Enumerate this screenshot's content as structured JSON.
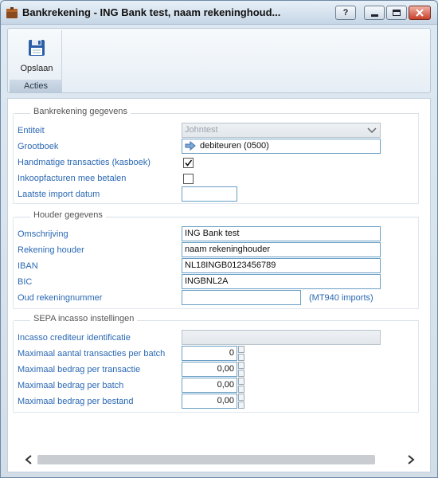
{
  "window": {
    "title": "Bankrekening - ING Bank test, naam rekeninghoud..."
  },
  "ribbon": {
    "save_label": "Opslaan",
    "group_label": "Acties"
  },
  "sections": {
    "bank": {
      "title": "Bankrekening gegevens"
    },
    "houder": {
      "title": "Houder gegevens"
    },
    "sepa": {
      "title": "SEPA incasso instellingen"
    }
  },
  "bank": {
    "entiteit_label": "Entiteit",
    "entiteit_value": "Johntest",
    "grootboek_label": "Grootboek",
    "grootboek_value": "debiteuren (0500)",
    "handmatig_label": "Handmatige transacties (kasboek)",
    "handmatig_checked": true,
    "inkoop_label": "Inkoopfacturen mee betalen",
    "inkoop_checked": false,
    "import_label": "Laatste import datum",
    "import_value": ""
  },
  "houder": {
    "omschrijving_label": "Omschrijving",
    "omschrijving_value": "ING Bank test",
    "rekening_houder_label": "Rekening houder",
    "rekening_houder_value": "naam rekeninghouder",
    "iban_label": "IBAN",
    "iban_value": "NL18INGB0123456789",
    "bic_label": "BIC",
    "bic_value": "INGBNL2A",
    "oud_label": "Oud rekeningnummer",
    "oud_value": "",
    "oud_suffix": "(MT940 imports)"
  },
  "sepa": {
    "crediteur_label": "Incasso crediteur identificatie",
    "crediteur_value": "",
    "max_trans_batch_label": "Maximaal aantal transacties per batch",
    "max_trans_batch_value": "0",
    "max_bedrag_trans_label": "Maximaal bedrag per transactie",
    "max_bedrag_trans_value": "0,00",
    "max_bedrag_batch_label": "Maximaal bedrag per batch",
    "max_bedrag_batch_value": "0,00",
    "max_bedrag_bestand_label": "Maximaal bedrag per bestand",
    "max_bedrag_bestand_value": "0,00"
  }
}
